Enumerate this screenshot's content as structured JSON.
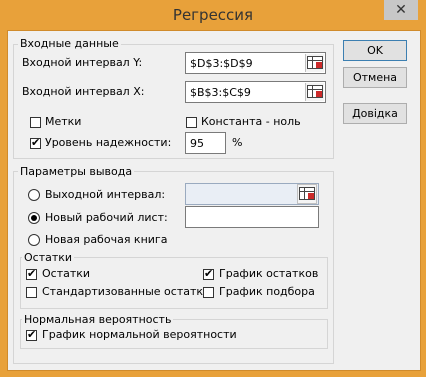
{
  "dialog": {
    "title": "Регрессия",
    "close_glyph": "✕"
  },
  "buttons": {
    "ok": "OK",
    "cancel": "Отмена",
    "help": "Довідка"
  },
  "input_group": {
    "title": "Входные данные",
    "y_label": "Входной интервал Y:",
    "y_value": "$D$3:$D$9",
    "x_label": "Входной интервал X:",
    "x_value": "$B$3:$C$9",
    "labels_label": "Метки",
    "labels_checked": false,
    "constant_zero_label": "Константа - ноль",
    "constant_zero_checked": false,
    "confidence_label": "Уровень надежности:",
    "confidence_checked": true,
    "confidence_value": "95",
    "confidence_unit": "%"
  },
  "output_group": {
    "title": "Параметры вывода",
    "output_range_label": "Выходной интервал:",
    "output_range_value": "",
    "new_sheet_label": "Новый рабочий лист:",
    "new_sheet_value": "",
    "new_workbook_label": "Новая рабочая книга",
    "selected": "new_sheet"
  },
  "residuals_group": {
    "title": "Остатки",
    "residuals_label": "Остатки",
    "residuals_checked": true,
    "residual_plot_label": "График остатков",
    "residual_plot_checked": true,
    "standardized_label": "Стандартизованные остатки",
    "standardized_checked": false,
    "line_fit_label": "График подбора",
    "line_fit_checked": false
  },
  "normal_group": {
    "title": "Нормальная вероятность",
    "normal_plot_label": "График нормальной вероятности",
    "normal_plot_checked": true
  }
}
